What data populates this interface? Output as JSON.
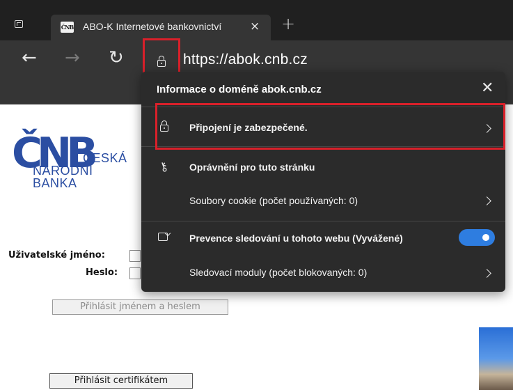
{
  "browser": {
    "tab": {
      "favicon_text": "ČNB",
      "title": "ABO-K Internetové bankovnictví",
      "close_glyph": "×"
    },
    "new_tab_glyph": "+",
    "nav": {
      "back": "←",
      "forward": "→",
      "refresh": "↻"
    },
    "address": {
      "url": "https://abok.cnb.cz"
    }
  },
  "site_info_panel": {
    "title": "Informace o doméně abok.cnb.cz",
    "close_glyph": "✕",
    "rows": {
      "connection": "Připojení je zabezpečené.",
      "permissions": "Oprávnění pro tuto stránku",
      "cookies": "Soubory cookie (počet používaných: 0)",
      "tracking_prevention": "Prevence sledování u tohoto webu (Vyvážené)",
      "trackers": "Sledovací moduly (počet blokovaných: 0)"
    },
    "tracking_toggle_on": true
  },
  "page": {
    "logo": {
      "letters": "ČNB",
      "line1": "ČESKÁ",
      "line2": "NÁRODNÍ",
      "line3": "BANKA"
    },
    "username_label": "Uživatelské jméno:",
    "password_label": "Heslo:",
    "login_password_button": "Přihlásit jménem a heslem",
    "login_certificate_button": "Přihlásit certifikátem"
  },
  "colors": {
    "highlight": "#d9202a",
    "toggle": "#2e7de0",
    "logo_blue": "#2b4ea2"
  }
}
